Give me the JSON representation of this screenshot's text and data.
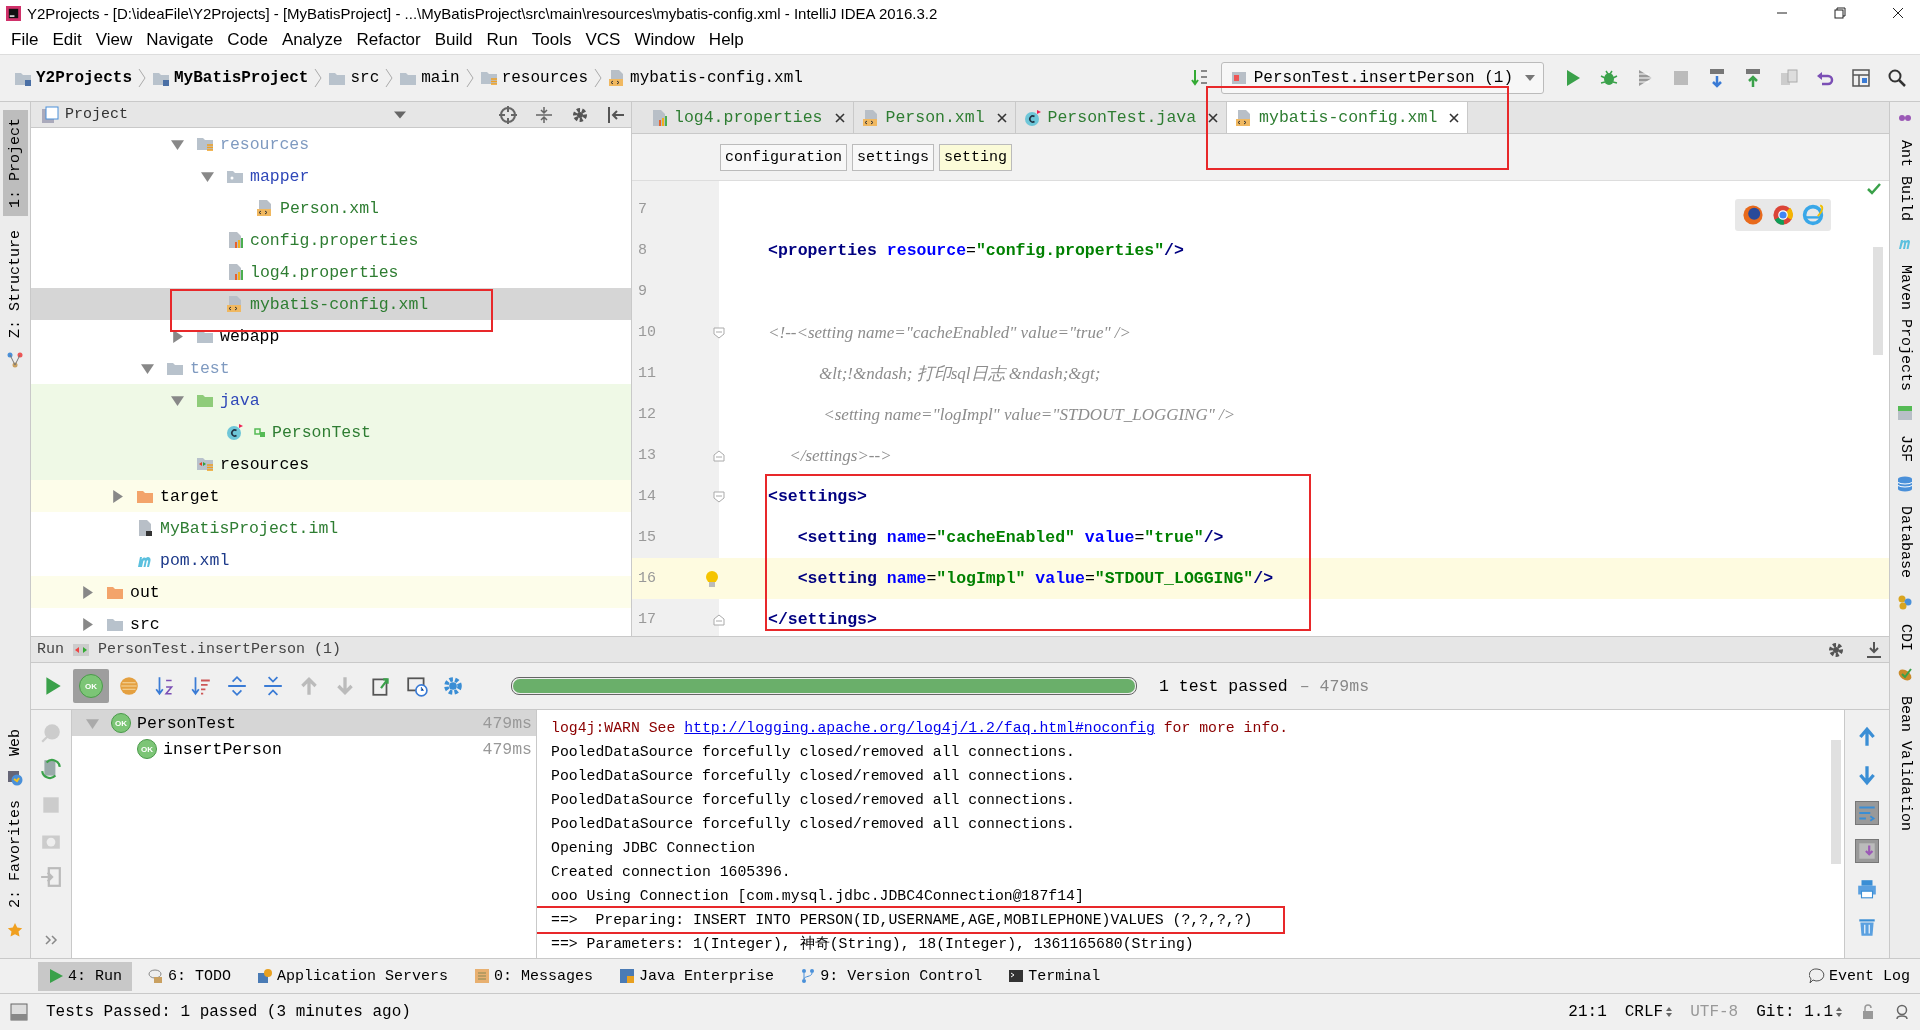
{
  "window": {
    "title": "Y2Projects - [D:\\ideaFile\\Y2Projects] - [MyBatisProject] - ...\\MyBatisProject\\src\\main\\resources\\mybatis-config.xml - IntelliJ IDEA 2016.3.2"
  },
  "menu": [
    "File",
    "Edit",
    "View",
    "Navigate",
    "Code",
    "Analyze",
    "Refactor",
    "Build",
    "Run",
    "Tools",
    "VCS",
    "Window",
    "Help"
  ],
  "navbar": {
    "breadcrumbs": [
      {
        "label": "Y2Projects",
        "kind": "project"
      },
      {
        "label": "MyBatisProject",
        "kind": "module"
      },
      {
        "label": "src",
        "kind": "folder"
      },
      {
        "label": "main",
        "kind": "folder"
      },
      {
        "label": "resources",
        "kind": "resources-folder"
      },
      {
        "label": "mybatis-config.xml",
        "kind": "xml-file"
      }
    ],
    "run_config": "PersonTest.insertPerson (1)"
  },
  "left_stripe": {
    "top": [
      {
        "label": "1: Project",
        "kind": "project",
        "selected": true
      },
      {
        "label": "Z: Structure",
        "kind": "structure",
        "selected": false
      }
    ],
    "bottom": [
      {
        "label": "Web",
        "kind": "web",
        "selected": false
      },
      {
        "label": "2: Favorites",
        "kind": "favorites",
        "selected": false
      }
    ]
  },
  "right_stripe": {
    "top": [
      {
        "label": "Ant Build",
        "kind": "ant"
      },
      {
        "label": "Maven Projects",
        "kind": "maven"
      },
      {
        "label": "JSF",
        "kind": "jsf"
      },
      {
        "label": "Database",
        "kind": "database"
      }
    ],
    "bottom": [
      {
        "label": "CDI",
        "kind": "cdi"
      },
      {
        "label": "Bean Validation",
        "kind": "bean"
      }
    ]
  },
  "project_panel": {
    "title": "Project",
    "tree": [
      {
        "children": [
          {
            "children": [
              {
                "children": [
                  {
                    "children": [
                      {
                        "label": "resources",
                        "kind": "resources-folder",
                        "color": "#7f9ac0",
                        "expanded": true,
                        "selected": false,
                        "children": [
                          {
                            "label": "mapper",
                            "kind": "package-folder",
                            "color": "#3048b8",
                            "expanded": true,
                            "selected": false,
                            "children": [
                              {
                                "label": "Person.xml",
                                "kind": "xml-file",
                                "color": "#2e7d32",
                                "selected": false
                              }
                            ]
                          },
                          {
                            "label": "config.properties",
                            "kind": "properties-file",
                            "color": "#2e7d32",
                            "selected": false
                          },
                          {
                            "label": "log4.properties",
                            "kind": "properties-file",
                            "color": "#2e7d32",
                            "selected": false
                          },
                          {
                            "label": "mybatis-config.xml",
                            "kind": "xml-file",
                            "color": "#2e7d32",
                            "selected": true
                          }
                        ]
                      },
                      {
                        "label": "webapp",
                        "kind": "folder",
                        "color": "#000000",
                        "expanded": false,
                        "selected": false
                      }
                    ]
                  },
                  {
                    "label": "test",
                    "kind": "folder",
                    "color": "#7f9ac0",
                    "expanded": true,
                    "selected": false,
                    "children": [
                      {
                        "label": "java",
                        "kind": "test-source-folder",
                        "color": "#3048b8",
                        "expanded": true,
                        "selected": false,
                        "children": [
                          {
                            "label": "PersonTest",
                            "kind": "class",
                            "color": "#2e7d32",
                            "selected": false
                          }
                        ]
                      },
                      {
                        "label": "resources",
                        "kind": "test-resources-folder",
                        "color": "#000000",
                        "selected": false
                      }
                    ]
                  }
                ]
              },
              {
                "label": "target",
                "kind": "excluded-folder",
                "color": "#000000",
                "expanded": false,
                "selected": false
              },
              {
                "label": "MyBatisProject.iml",
                "kind": "iml-file",
                "color": "#2e7d32",
                "selected": false
              },
              {
                "label": "pom.xml",
                "kind": "maven-file",
                "color": "#1d3a8a",
                "selected": false
              }
            ]
          },
          {
            "label": "out",
            "kind": "excluded-folder",
            "color": "#000000",
            "expanded": false,
            "selected": false
          },
          {
            "label": "src",
            "kind": "folder",
            "color": "#000000",
            "expanded": false,
            "selected": false
          }
        ]
      }
    ]
  },
  "editor": {
    "tabs": [
      {
        "label": "log4.properties",
        "kind": "properties-file",
        "selected": false
      },
      {
        "label": "Person.xml",
        "kind": "xml-file",
        "selected": false
      },
      {
        "label": "PersonTest.java",
        "kind": "class",
        "selected": false
      },
      {
        "label": "mybatis-config.xml",
        "kind": "xml-file",
        "selected": true
      }
    ],
    "breadcrumbs": [
      {
        "label": "configuration",
        "selected": false
      },
      {
        "label": "settings",
        "selected": false
      },
      {
        "label": "setting",
        "selected": true
      }
    ],
    "lines": [
      {
        "number": "7",
        "current": false,
        "intention": false,
        "fold_start": false,
        "fold_end": false
      },
      {
        "number": "8",
        "current": false,
        "intention": false,
        "fold_start": false,
        "fold_end": false,
        "tokens": [
          {
            "kind": "tag",
            "text": "<properties"
          },
          {
            "kind": "attr",
            "text": " resource"
          },
          {
            "kind": "plain",
            "text": "="
          },
          {
            "kind": "value",
            "text": "\"config.properties\""
          },
          {
            "kind": "tag",
            "text": "/>"
          }
        ]
      },
      {
        "number": "9",
        "current": false,
        "intention": false,
        "fold_start": false,
        "fold_end": false
      },
      {
        "number": "10",
        "current": false,
        "intention": false,
        "fold_start": true,
        "fold_end": false,
        "tokens": [
          {
            "kind": "comment",
            "text": "<!--<setting name=\"cacheEnabled\" value=\"true\" />"
          }
        ]
      },
      {
        "number": "11",
        "current": false,
        "intention": false,
        "fold_start": false,
        "fold_end": false,
        "tokens": [
          {
            "kind": "comment",
            "text": "            &lt;!&ndash; 打印sql日志 &ndash;&gt;"
          }
        ]
      },
      {
        "number": "12",
        "current": false,
        "intention": false,
        "fold_start": false,
        "fold_end": false,
        "tokens": [
          {
            "kind": "comment",
            "text": "             <setting name=\"logImpl\" value=\"STDOUT_LOGGING\" />"
          }
        ]
      },
      {
        "number": "13",
        "current": false,
        "intention": false,
        "fold_start": false,
        "fold_end": true,
        "tokens": [
          {
            "kind": "comment",
            "text": "     </settings>-->"
          }
        ]
      },
      {
        "number": "14",
        "current": false,
        "intention": false,
        "fold_start": true,
        "fold_end": false,
        "tokens": [
          {
            "kind": "tag",
            "text": "<settings>"
          }
        ]
      },
      {
        "number": "15",
        "current": false,
        "intention": false,
        "fold_start": false,
        "fold_end": false,
        "tokens": [
          {
            "kind": "tag",
            "text": "   <setting"
          },
          {
            "kind": "attr",
            "text": " name"
          },
          {
            "kind": "plain",
            "text": "="
          },
          {
            "kind": "value",
            "text": "\"cacheEnabled\""
          },
          {
            "kind": "attr",
            "text": " value"
          },
          {
            "kind": "plain",
            "text": "="
          },
          {
            "kind": "value",
            "text": "\"true\""
          },
          {
            "kind": "tag",
            "text": "/>"
          }
        ]
      },
      {
        "number": "16",
        "current": true,
        "intention": true,
        "fold_start": false,
        "fold_end": false,
        "tokens": [
          {
            "kind": "tag",
            "text": "   <setting"
          },
          {
            "kind": "attr",
            "text": " name"
          },
          {
            "kind": "plain",
            "text": "="
          },
          {
            "kind": "value",
            "text": "\"logImpl\""
          },
          {
            "kind": "attr",
            "text": " value"
          },
          {
            "kind": "plain",
            "text": "="
          },
          {
            "kind": "value",
            "text": "\"STDOUT_LOGGING\""
          },
          {
            "kind": "tag",
            "text": "/>"
          }
        ]
      },
      {
        "number": "17",
        "current": false,
        "intention": false,
        "fold_start": false,
        "fold_end": true,
        "tokens": [
          {
            "kind": "tag",
            "text": "</settings>"
          }
        ]
      }
    ]
  },
  "run_panel": {
    "title": "Run",
    "config": "PersonTest.insertPerson (1)",
    "show_passed": {
      "label": "OK",
      "selected": true
    },
    "progress": {
      "level": 1
    },
    "summary": "1 test passed",
    "duration": "– 479ms",
    "tests": [
      {
        "label": "PersonTest",
        "time": "479ms",
        "status": "OK",
        "selected": true,
        "expanded": true,
        "children": [
          {
            "label": "insertPerson",
            "time": "479ms",
            "status": "OK",
            "selected": false
          }
        ]
      }
    ],
    "console": [
      {
        "kind": "warn",
        "annotated": false,
        "prefix": "log4j:WARN See ",
        "link": "http://logging.apache.org/log4j/1.2/faq.html#noconfig",
        "suffix": " for more info."
      },
      {
        "kind": "text",
        "annotated": false,
        "text": "PooledDataSource forcefully closed/removed all connections."
      },
      {
        "kind": "text",
        "annotated": false,
        "text": "PooledDataSource forcefully closed/removed all connections."
      },
      {
        "kind": "text",
        "annotated": false,
        "text": "PooledDataSource forcefully closed/removed all connections."
      },
      {
        "kind": "text",
        "annotated": false,
        "text": "PooledDataSource forcefully closed/removed all connections."
      },
      {
        "kind": "text",
        "annotated": false,
        "text": "Opening JDBC Connection"
      },
      {
        "kind": "text",
        "annotated": false,
        "text": "Created connection 1605396."
      },
      {
        "kind": "text",
        "annotated": false,
        "text": "ooo Using Connection [com.mysql.jdbc.JDBC4Connection@187f14]"
      },
      {
        "kind": "text",
        "annotated": true,
        "text": "==>  Preparing: INSERT INTO PERSON(ID,USERNAME,AGE,MOBILEPHONE)VALUES (?,?,?,?)"
      },
      {
        "kind": "text",
        "annotated": false,
        "text": "==> Parameters: 1(Integer), 神奇(String), 18(Integer), 1361165680(String)"
      }
    ]
  },
  "bottom_tabs": [
    {
      "label": "4: Run",
      "kind": "run",
      "selected": true
    },
    {
      "label": "6: TODO",
      "kind": "todo",
      "selected": false
    },
    {
      "label": "Application Servers",
      "kind": "servers",
      "selected": false
    },
    {
      "label": "0: Messages",
      "kind": "messages",
      "selected": false
    },
    {
      "label": "Java Enterprise",
      "kind": "enterprise",
      "selected": false
    },
    {
      "label": "9: Version Control",
      "kind": "vcs",
      "selected": false
    },
    {
      "label": "Terminal",
      "kind": "terminal",
      "selected": false
    }
  ],
  "event_log": "Event Log",
  "status_bar": {
    "message": "Tests Passed: 1 passed (3 minutes ago)",
    "position": "21:1",
    "line_separator": "CRLF",
    "encoding": "UTF-8",
    "vcs": "Git: 1.1"
  }
}
